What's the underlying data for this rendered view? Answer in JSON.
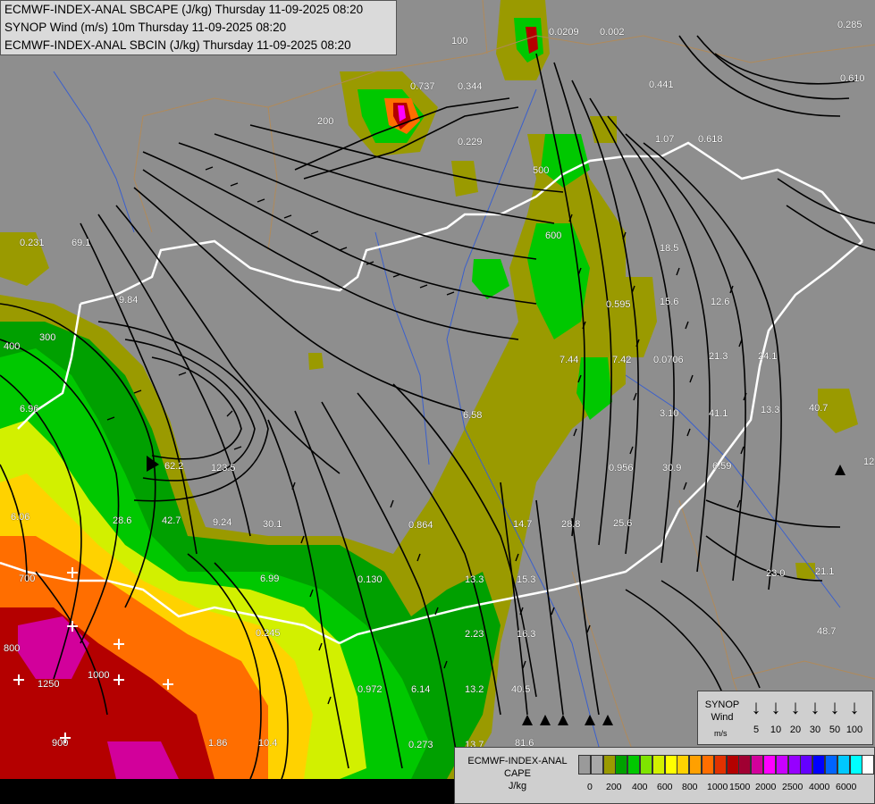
{
  "title_lines": [
    "ECMWF-INDEX-ANAL SBCAPE (J/kg) Thursday 11-09-2025 08:20",
    "SYNOP Wind (m/s) 10m Thursday 11-09-2025 08:20",
    "ECMWF-INDEX-ANAL SBCIN (J/kg) Thursday 11-09-2025 08:20"
  ],
  "map_labels": [
    "0.285",
    "0.610",
    "0.0209",
    "0.002",
    "0.737",
    "0.344",
    "0.229",
    "0.441",
    "1.07",
    "0.618",
    "0.231",
    "69.1",
    "9.84",
    "18.5",
    "12.6",
    "15.6",
    "0.595",
    "7.44",
    "7.42",
    "0.0706",
    "21.3",
    "24.1",
    "3.10",
    "41.1",
    "13.3",
    "40.7",
    "6.58",
    "62.2",
    "123.5",
    "6.96",
    "6.06",
    "28.6",
    "42.7",
    "9.24",
    "30.1",
    "0.864",
    "14.7",
    "28.8",
    "25.6",
    "0.956",
    "30.9",
    "6.59",
    "23.0",
    "21.1",
    "6.99",
    "0.130",
    "13.3",
    "16.3",
    "15.3",
    "2.23",
    "0.245",
    "0.972",
    "6.14",
    "13.2",
    "40.5",
    "10.4",
    "1.86",
    "0.273",
    "13.7",
    "81.6",
    "48.7",
    "12",
    "100",
    "200",
    "300",
    "400",
    "500",
    "600",
    "700",
    "800",
    "900",
    "1000",
    "1250"
  ],
  "synop_legend": {
    "title_line1": "SYNOP",
    "title_line2": "Wind",
    "unit": "m/s",
    "values": [
      "5",
      "10",
      "20",
      "30",
      "50",
      "100"
    ],
    "arrow_icon": "down-arrow-icon"
  },
  "cape_legend": {
    "title_line1": "ECMWF-INDEX-ANAL",
    "title_line2": "CAPE",
    "unit": "J/kg",
    "ticks": [
      "0",
      "200",
      "400",
      "600",
      "800",
      "1000",
      "1500",
      "2000",
      "2500",
      "4000",
      "6000"
    ],
    "colors": [
      "#9a9a9a",
      "#a8a8a8",
      "#9a9a00",
      "#00a000",
      "#00c800",
      "#7ee400",
      "#d2f000",
      "#ffff00",
      "#ffd200",
      "#ffa000",
      "#ff6e00",
      "#e13200",
      "#b40000",
      "#a00032",
      "#d2009b",
      "#ff00ff",
      "#c800ff",
      "#9600ff",
      "#6400ff",
      "#0000ff",
      "#0064ff",
      "#00c8ff",
      "#00ffff",
      "#ffffff"
    ]
  },
  "colors": {
    "background_gray": "#8e8e8e",
    "border_white": "#ffffff",
    "streamline": "#000000",
    "river_blue": "#3a5fcd",
    "admin_brown": "#b08a5a"
  }
}
